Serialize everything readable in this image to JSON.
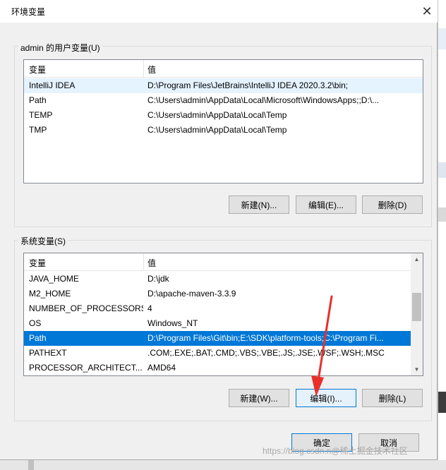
{
  "window": {
    "title": "环境变量"
  },
  "user_vars": {
    "group_label": "admin 的用户变量(U)",
    "columns": [
      "变量",
      "值"
    ],
    "rows": [
      {
        "name": "IntelliJ IDEA",
        "value": "D:\\Program Files\\JetBrains\\IntelliJ IDEA 2020.3.2\\bin;"
      },
      {
        "name": "Path",
        "value": "C:\\Users\\admin\\AppData\\Local\\Microsoft\\WindowsApps;;D:\\..."
      },
      {
        "name": "TEMP",
        "value": "C:\\Users\\admin\\AppData\\Local\\Temp"
      },
      {
        "name": "TMP",
        "value": "C:\\Users\\admin\\AppData\\Local\\Temp"
      }
    ],
    "buttons": {
      "new": "新建(N)...",
      "edit": "编辑(E)...",
      "delete": "删除(D)"
    }
  },
  "system_vars": {
    "group_label": "系统变量(S)",
    "columns": [
      "变量",
      "值"
    ],
    "rows": [
      {
        "name": "JAVA_HOME",
        "value": "D:\\jdk"
      },
      {
        "name": "M2_HOME",
        "value": "D:\\apache-maven-3.3.9"
      },
      {
        "name": "NUMBER_OF_PROCESSORS",
        "value": "4"
      },
      {
        "name": "OS",
        "value": "Windows_NT"
      },
      {
        "name": "Path",
        "value": "D:\\Program Files\\Git\\bin;E:\\SDK\\platform-tools;C:\\Program Fi..."
      },
      {
        "name": "PATHEXT",
        "value": ".COM;.EXE;.BAT;.CMD;.VBS;.VBE;.JS;.JSE;.WSF;.WSH;.MSC"
      },
      {
        "name": "PROCESSOR_ARCHITECT...",
        "value": "AMD64"
      }
    ],
    "selected_row": 4,
    "buttons": {
      "new": "新建(W)...",
      "edit": "编辑(I)...",
      "delete": "删除(L)"
    }
  },
  "footer": {
    "ok": "确定",
    "cancel": "取消"
  },
  "watermark": "https://blog.csdn.n@稀土掘金技术社区",
  "colors": {
    "selection": "#0078d7",
    "hover": "#e5f3ff",
    "annotation_arrow": "#e8302a"
  },
  "icons": {
    "close": "close-icon",
    "scroll_up": "chevron-up-icon",
    "scroll_down": "chevron-down-icon"
  }
}
